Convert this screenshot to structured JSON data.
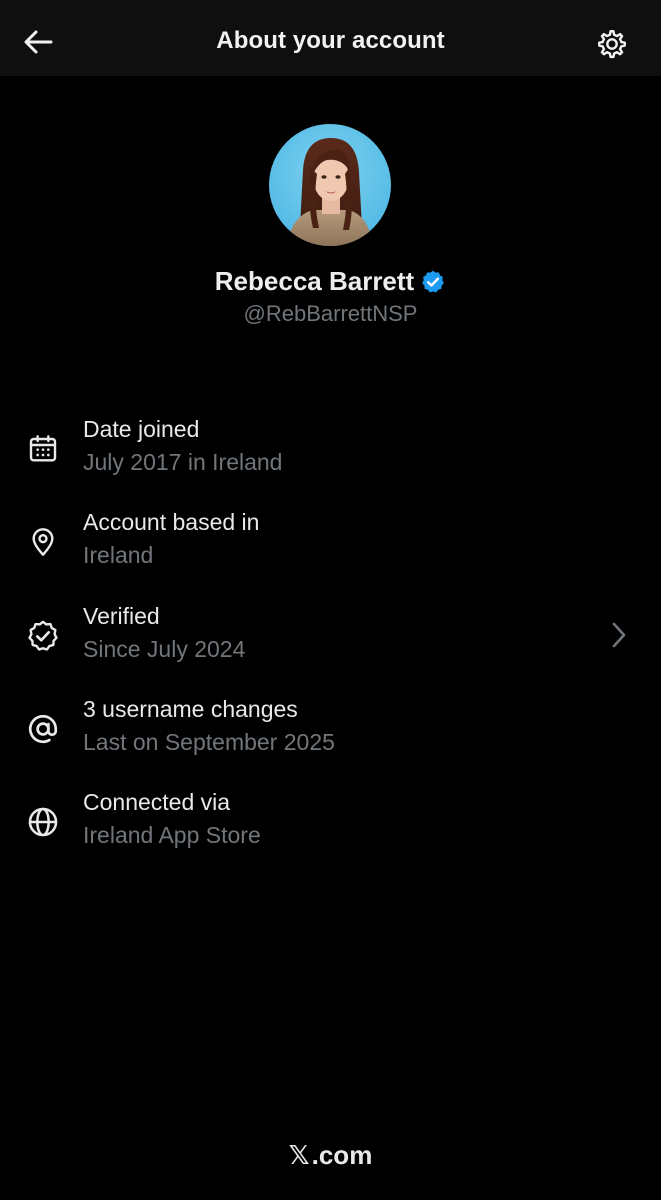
{
  "header": {
    "title": "About your account",
    "back_icon": "arrow-left-icon",
    "settings_icon": "gear-icon"
  },
  "profile": {
    "name": "Rebecca Barrett",
    "handle": "@RebBarrettNSP",
    "verified_badge_icon": "verified-badge-icon",
    "verified_color": "#1d9bf0"
  },
  "rows": [
    {
      "title": "Date joined",
      "subtitle": "July 2017 in Ireland",
      "icon": "calendar-icon"
    },
    {
      "title": "Account based in",
      "subtitle": "Ireland",
      "icon": "location-pin-icon"
    },
    {
      "title": "Verified",
      "subtitle": "Since July 2024",
      "icon": "verified-check-icon",
      "has_chevron": true
    },
    {
      "title": "3 username changes",
      "subtitle": "Last on September 2025",
      "icon": "at-sign-icon"
    },
    {
      "title": "Connected via",
      "subtitle": "Ireland App Store",
      "icon": "globe-icon"
    }
  ],
  "footer": {
    "logo": "𝕏",
    "domain": ".com"
  },
  "colors": {
    "background": "#000000",
    "topbar": "#0f0f10",
    "primary_text": "#e7e9ea",
    "secondary_text": "#71767b"
  }
}
